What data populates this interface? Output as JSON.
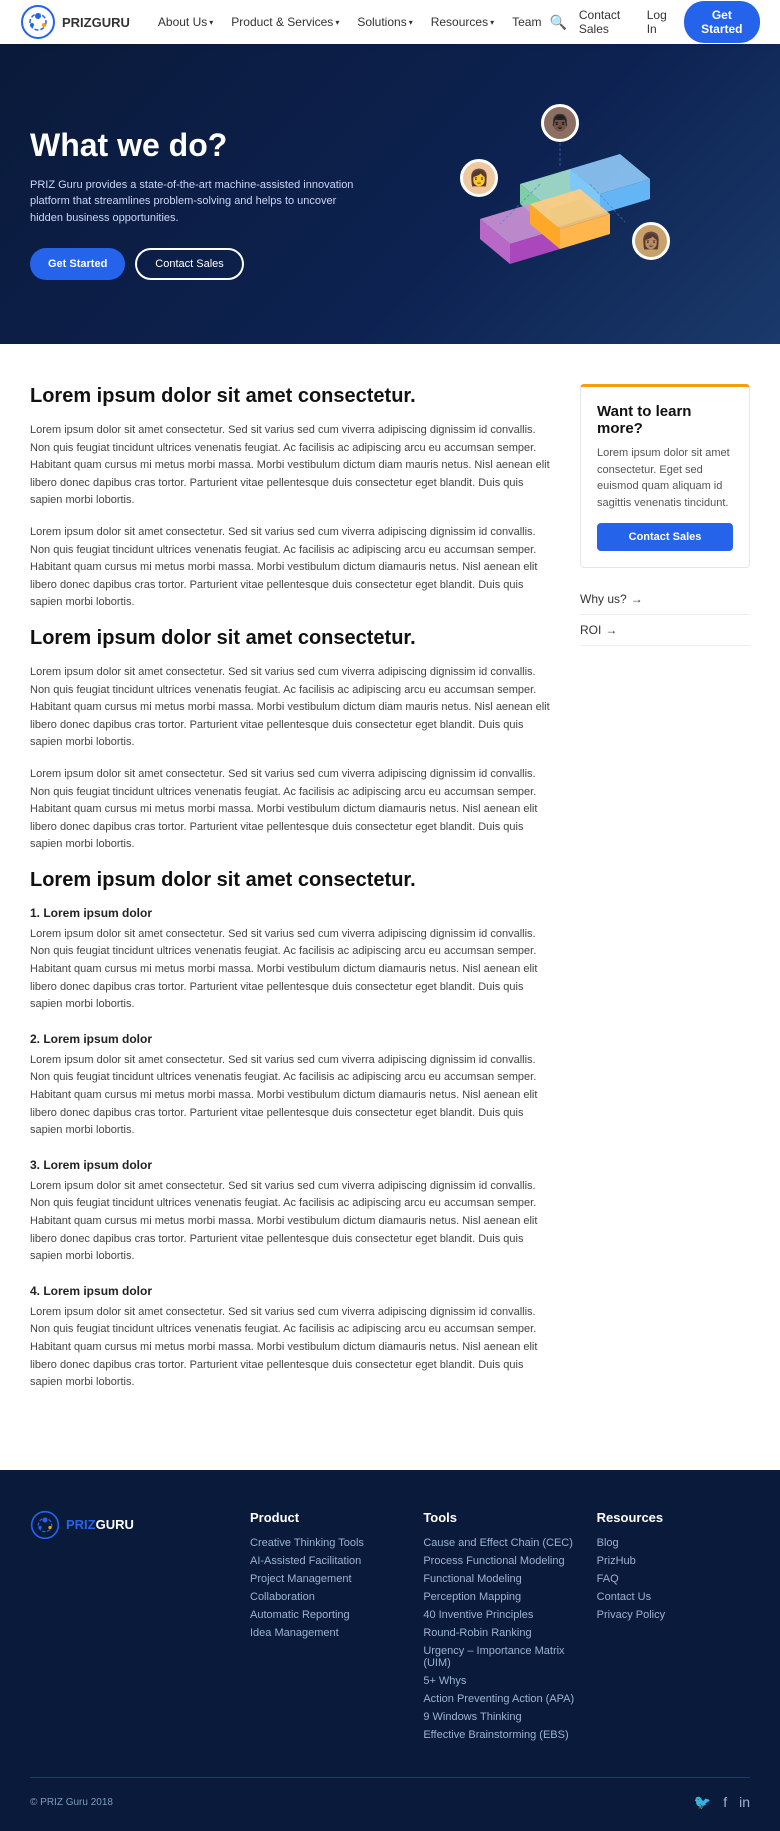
{
  "navbar": {
    "logo_text": "PRIZGURU",
    "nav_items": [
      {
        "label": "About Us",
        "has_dropdown": true
      },
      {
        "label": "Product & Services",
        "has_dropdown": true
      },
      {
        "label": "Solutions",
        "has_dropdown": true
      },
      {
        "label": "Resources",
        "has_dropdown": true
      },
      {
        "label": "Team",
        "has_dropdown": false
      }
    ],
    "contact_sales": "Contact Sales",
    "login": "Log In",
    "get_started": "Get Started"
  },
  "hero": {
    "title": "What we do?",
    "description": "PRIZ Guru provides a state-of-the-art machine-assisted innovation platform that streamlines problem-solving and helps to uncover hidden business opportunities.",
    "btn_primary": "Get Started",
    "btn_outline": "Contact Sales"
  },
  "section1": {
    "title": "Lorem ipsum dolor sit amet consectetur.",
    "para1": "Lorem ipsum dolor sit amet consectetur. Sed sit varius sed cum viverra adipiscing dignissim id convallis. Non quis feugiat tincidunt ultrices venenatis feugiat. Ac facilisis ac adipiscing arcu eu accumsan semper. Habitant quam cursus mi metus morbi massa. Morbi vestibulum dictum diam mauris netus. Nisl aenean elit libero donec dapibus cras tortor. Parturient vitae pellentesque duis consectetur eget blandit. Duis quis sapien morbi lobortis.",
    "para2": "Lorem ipsum dolor sit amet consectetur. Sed sit varius sed cum viverra adipiscing dignissim id convallis. Non quis feugiat tincidunt ultrices venenatis feugiat. Ac facilisis ac adipiscing arcu eu accumsan semper. Habitant quam cursus mi metus morbi massa. Morbi vestibulum dictum diamauris netus. Nisl aenean elit libero donec dapibus cras tortor. Parturient vitae pellentesque duis consectetur eget blandit. Duis quis sapien morbi lobortis."
  },
  "section2": {
    "title": "Lorem ipsum dolor sit amet consectetur.",
    "para1": "Lorem ipsum dolor sit amet consectetur. Sed sit varius sed cum viverra adipiscing dignissim id convallis. Non quis feugiat tincidunt ultrices venenatis feugiat. Ac facilisis ac adipiscing arcu eu accumsan semper. Habitant quam cursus mi metus morbi massa. Morbi vestibulum dictum diam mauris netus. Nisl aenean elit libero donec dapibus cras tortor. Parturient vitae pellentesque duis consectetur eget blandit. Duis quis sapien morbi lobortis.",
    "para2": "Lorem ipsum dolor sit amet consectetur. Sed sit varius sed cum viverra adipiscing dignissim id convallis. Non quis feugiat tincidunt ultrices venenatis feugiat. Ac facilisis ac adipiscing arcu eu accumsan semper. Habitant quam cursus mi metus morbi massa. Morbi vestibulum dictum diamauris netus. Nisl aenean elit libero donec dapibus cras tortor. Parturient vitae pellentesque duis consectetur eget blandit. Duis quis sapien morbi lobortis."
  },
  "section3": {
    "title": "Lorem ipsum dolor sit amet consectetur.",
    "items": [
      {
        "num": "1.",
        "subtitle": "Lorem ipsum dolor",
        "para": "Lorem ipsum dolor sit amet consectetur. Sed sit varius sed cum viverra adipiscing dignissim id convallis. Non quis feugiat tincidunt ultrices venenatis feugiat. Ac facilisis ac adipiscing arcu eu accumsan semper. Habitant quam cursus mi metus morbi massa. Morbi vestibulum dictum diamauris netus. Nisl aenean elit libero donec dapibus cras tortor. Parturient vitae pellentesque duis consectetur eget blandit. Duis quis sapien morbi lobortis."
      },
      {
        "num": "2.",
        "subtitle": "Lorem ipsum dolor",
        "para": "Lorem ipsum dolor sit amet consectetur. Sed sit varius sed cum viverra adipiscing dignissim id convallis. Non quis feugiat tincidunt ultrices venenatis feugiat. Ac facilisis ac adipiscing arcu eu accumsan semper. Habitant quam cursus mi metus morbi massa. Morbi vestibulum dictum diamauris netus. Nisl aenean elit libero donec dapibus cras tortor. Parturient vitae pellentesque duis consectetur eget blandit. Duis quis sapien morbi lobortis."
      },
      {
        "num": "3.",
        "subtitle": "Lorem ipsum dolor",
        "para": "Lorem ipsum dolor sit amet consectetur. Sed sit varius sed cum viverra adipiscing dignissim id convallis. Non quis feugiat tincidunt ultrices venenatis feugiat. Ac facilisis ac adipiscing arcu eu accumsan semper. Habitant quam cursus mi metus morbi massa. Morbi vestibulum dictum diamauris netus. Nisl aenean elit libero donec dapibus cras tortor. Parturient vitae pellentesque duis consectetur eget blandit. Duis quis sapien morbi lobortis."
      },
      {
        "num": "4.",
        "subtitle": "Lorem ipsum dolor",
        "para": "Lorem ipsum dolor sit amet consectetur. Sed sit varius sed cum viverra adipiscing dignissim id convallis. Non quis feugiat tincidunt ultrices venenatis feugiat. Ac facilisis ac adipiscing arcu eu accumsan semper. Habitant quam cursus mi metus morbi massa. Morbi vestibulum dictum diamauris netus. Nisl aenean elit libero donec dapibus cras tortor. Parturient vitae pellentesque duis consectetur eget blandit. Duis quis sapien morbi lobortis."
      }
    ]
  },
  "sidebar": {
    "card_title": "Want to learn more?",
    "card_text": "Lorem ipsum dolor sit amet consectetur. Eget sed euismod quam aliquam id sagittis venenatis tincidunt.",
    "contact_btn": "Contact Sales",
    "links": [
      {
        "label": "Why us?"
      },
      {
        "label": "ROI"
      }
    ]
  },
  "footer": {
    "logo": "PRIZGURU",
    "copyright": "© PRIZ Guru 2018",
    "columns": [
      {
        "title": "Product",
        "links": [
          "Creative Thinking Tools",
          "AI-Assisted Facilitation",
          "Project Management",
          "Collaboration",
          "Automatic Reporting",
          "Idea Management"
        ]
      },
      {
        "title": "Tools",
        "links": [
          "Cause and Effect Chain (CEC)",
          "Process Functional Modeling",
          "Functional Modeling",
          "Perception Mapping",
          "40 Inventive Principles",
          "Round-Robin Ranking",
          "Urgency – Importance Matrix (UIM)",
          "5+ Whys",
          "Action Preventing Action (APA)",
          "9 Windows Thinking",
          "Effective Brainstorming (EBS)"
        ]
      },
      {
        "title": "Resources",
        "links": [
          "Blog",
          "PrizHub",
          "FAQ",
          "Contact Us",
          "Privacy Policy"
        ]
      }
    ],
    "social_icons": [
      "twitter",
      "facebook",
      "linkedin"
    ]
  }
}
